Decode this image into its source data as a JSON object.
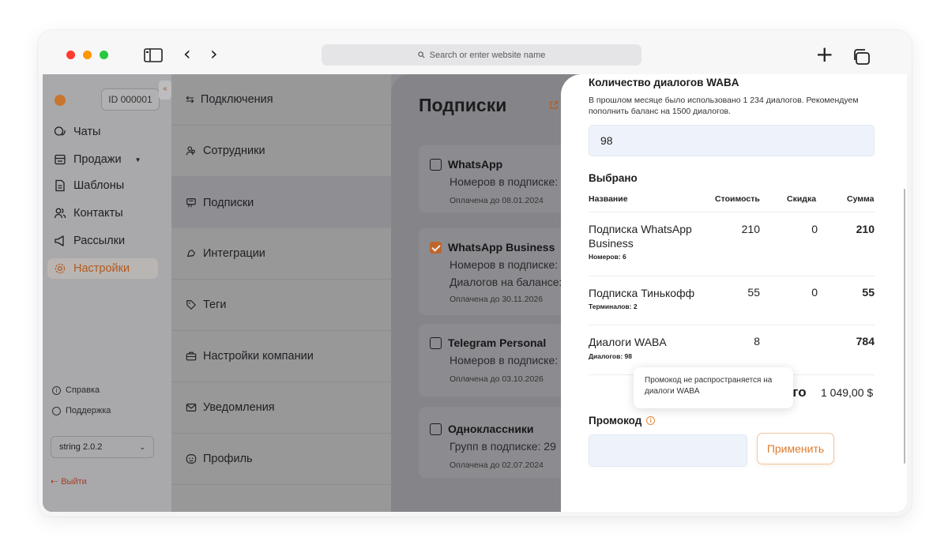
{
  "browser": {
    "address_placeholder": "Search or enter website name",
    "colors": {
      "close": "#ff3b30",
      "minimize": "#ff9500",
      "zoom": "#28c840"
    }
  },
  "sidebar": {
    "account_id": "ID 000001",
    "collapse_glyph": "«",
    "items": [
      {
        "label": "Чаты",
        "icon": "chat-icon"
      },
      {
        "label": "Продажи",
        "icon": "sales-icon",
        "has_dropdown": true
      },
      {
        "label": "Шаблоны",
        "icon": "template-icon"
      },
      {
        "label": "Контакты",
        "icon": "contacts-icon"
      },
      {
        "label": "Рассылки",
        "icon": "megaphone-icon"
      },
      {
        "label": "Настройки",
        "icon": "gear-icon",
        "active": true
      }
    ],
    "help": "Справка",
    "support": "Поддержка",
    "version": "string 2.0.2",
    "logout": "Выйти",
    "accent_color": "#e0792d"
  },
  "settings_menu": [
    {
      "label": "Подключения",
      "icon": "connections-icon"
    },
    {
      "label": "Сотрудники",
      "icon": "employees-icon"
    },
    {
      "label": "Подписки",
      "icon": "subscriptions-icon",
      "active": true
    },
    {
      "label": "Интеграции",
      "icon": "integrations-icon"
    },
    {
      "label": "Теги",
      "icon": "tag-icon"
    },
    {
      "label": "Настройки компании",
      "icon": "company-icon"
    },
    {
      "label": "Уведомления",
      "icon": "mail-icon"
    },
    {
      "label": "Профиль",
      "icon": "profile-icon"
    }
  ],
  "subscriptions": {
    "title": "Подписки",
    "cards": [
      {
        "name": "WhatsApp",
        "checked": false,
        "lines": [
          "Номеров в подписке:"
        ],
        "paid": "Оплачена до 08.01.2024"
      },
      {
        "name": "WhatsApp Business",
        "checked": true,
        "lines": [
          "Номеров в подписке:",
          "Диалогов на балансе:"
        ],
        "paid": "Оплачена до 30.11.2026"
      },
      {
        "name": "Telegram Personal",
        "checked": false,
        "lines": [
          "Номеров в подписке:"
        ],
        "paid": "Оплачена до 03.10.2026"
      },
      {
        "name": "Одноклассники",
        "checked": false,
        "lines": [
          "Групп в подписке: 29"
        ],
        "paid": "Оплачена до 02.07.2024"
      }
    ]
  },
  "drawer": {
    "waba_title": "Количество диалогов WABA",
    "waba_hint": "В прошлом месяце было использовано 1 234 диалогов. Рекомендуем пополнить баланс на 1500 диалогов.",
    "waba_value": "98",
    "selected_title": "Выбрано",
    "columns": {
      "name": "Название",
      "cost": "Стоимость",
      "discount": "Скидка",
      "sum": "Сумма"
    },
    "rows": [
      {
        "name": "Подписка WhatsApp Business",
        "sub": "Номеров: 6",
        "cost": "210",
        "discount": "0",
        "sum": "210"
      },
      {
        "name": "Подписка Тинькофф",
        "sub": "Терминалов: 2",
        "cost": "55",
        "discount": "0",
        "sum": "55"
      },
      {
        "name": "Диалоги WABA",
        "sub": "Диалогов: 98",
        "cost": "8",
        "discount": "",
        "sum": "784"
      }
    ],
    "total_label_visible": "ого",
    "total_value": "1 049,00 $",
    "tooltip": "Промокод не распространяется на диалоги WABA",
    "promo_title": "Промокод",
    "promo_value": "",
    "apply_label": "Применить"
  }
}
